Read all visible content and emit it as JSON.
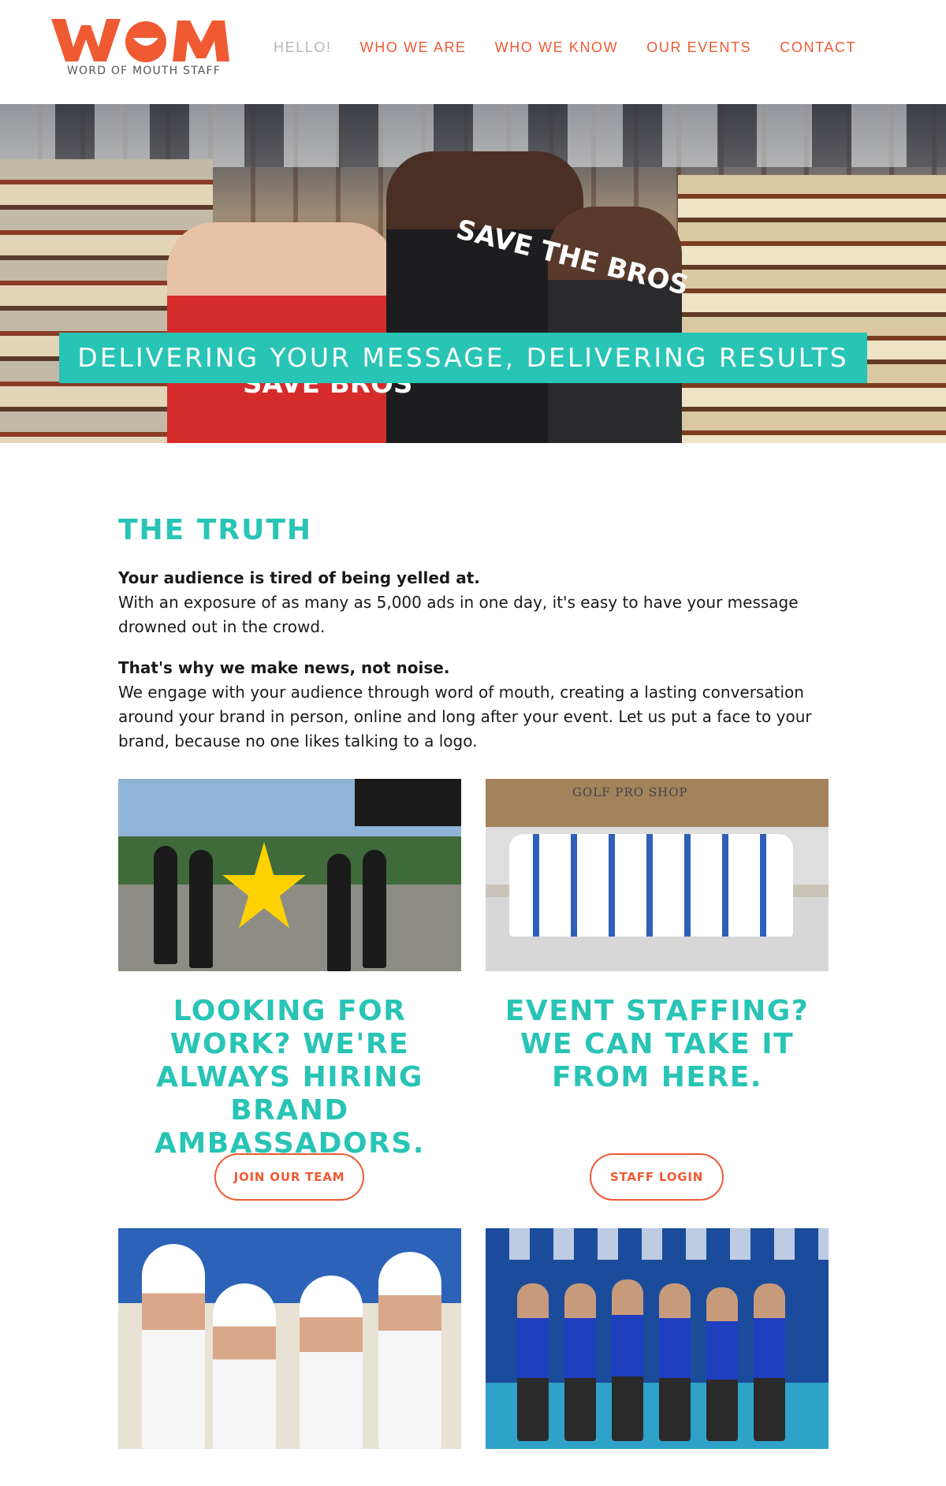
{
  "header": {
    "logo_text": "WOM",
    "logo_tagline": "WORD OF MOUTH STAFF",
    "nav": [
      {
        "label": "HELLO!",
        "active": true
      },
      {
        "label": "WHO WE ARE",
        "active": false
      },
      {
        "label": "WHO WE KNOW",
        "active": false
      },
      {
        "label": "OUR EVENTS",
        "active": false
      },
      {
        "label": "CONTACT",
        "active": false
      }
    ]
  },
  "hero": {
    "banner": "DELIVERING YOUR MESSAGE, DELIVERING RESULTS",
    "shirt_text_1": "SAVE BROS",
    "shirt_text_2": "SAVE THE BROS"
  },
  "truth": {
    "title": "THE TRUTH",
    "p1_bold": "Your audience is tired of being yelled at.",
    "p1_text": "With an exposure of as many as 5,000 ads in one day,  it's easy to have your message drowned out in the crowd.",
    "p2_bold": "That's why we make news, not noise.",
    "p2_text": "We engage with your audience through word of mouth, creating a lasting conversation around your brand in person, online and long after your event.  Let us put a face to your brand, because no one likes talking to a logo."
  },
  "photos": {
    "golf_sign": "GOLF PRO SHOP"
  },
  "callouts": {
    "work_title": "LOOKING FOR WORK? WE'RE ALWAYS HIRING BRAND AMBASSADORS.",
    "work_button": "JOIN OUR TEAM",
    "staffing_title": "EVENT STAFFING? WE CAN TAKE IT FROM HERE.",
    "staffing_button": "STAFF LOGIN"
  },
  "colors": {
    "accent_orange": "#ef5a33",
    "accent_teal": "#28c4b5",
    "nav_active_gray": "#b5b5b5"
  }
}
